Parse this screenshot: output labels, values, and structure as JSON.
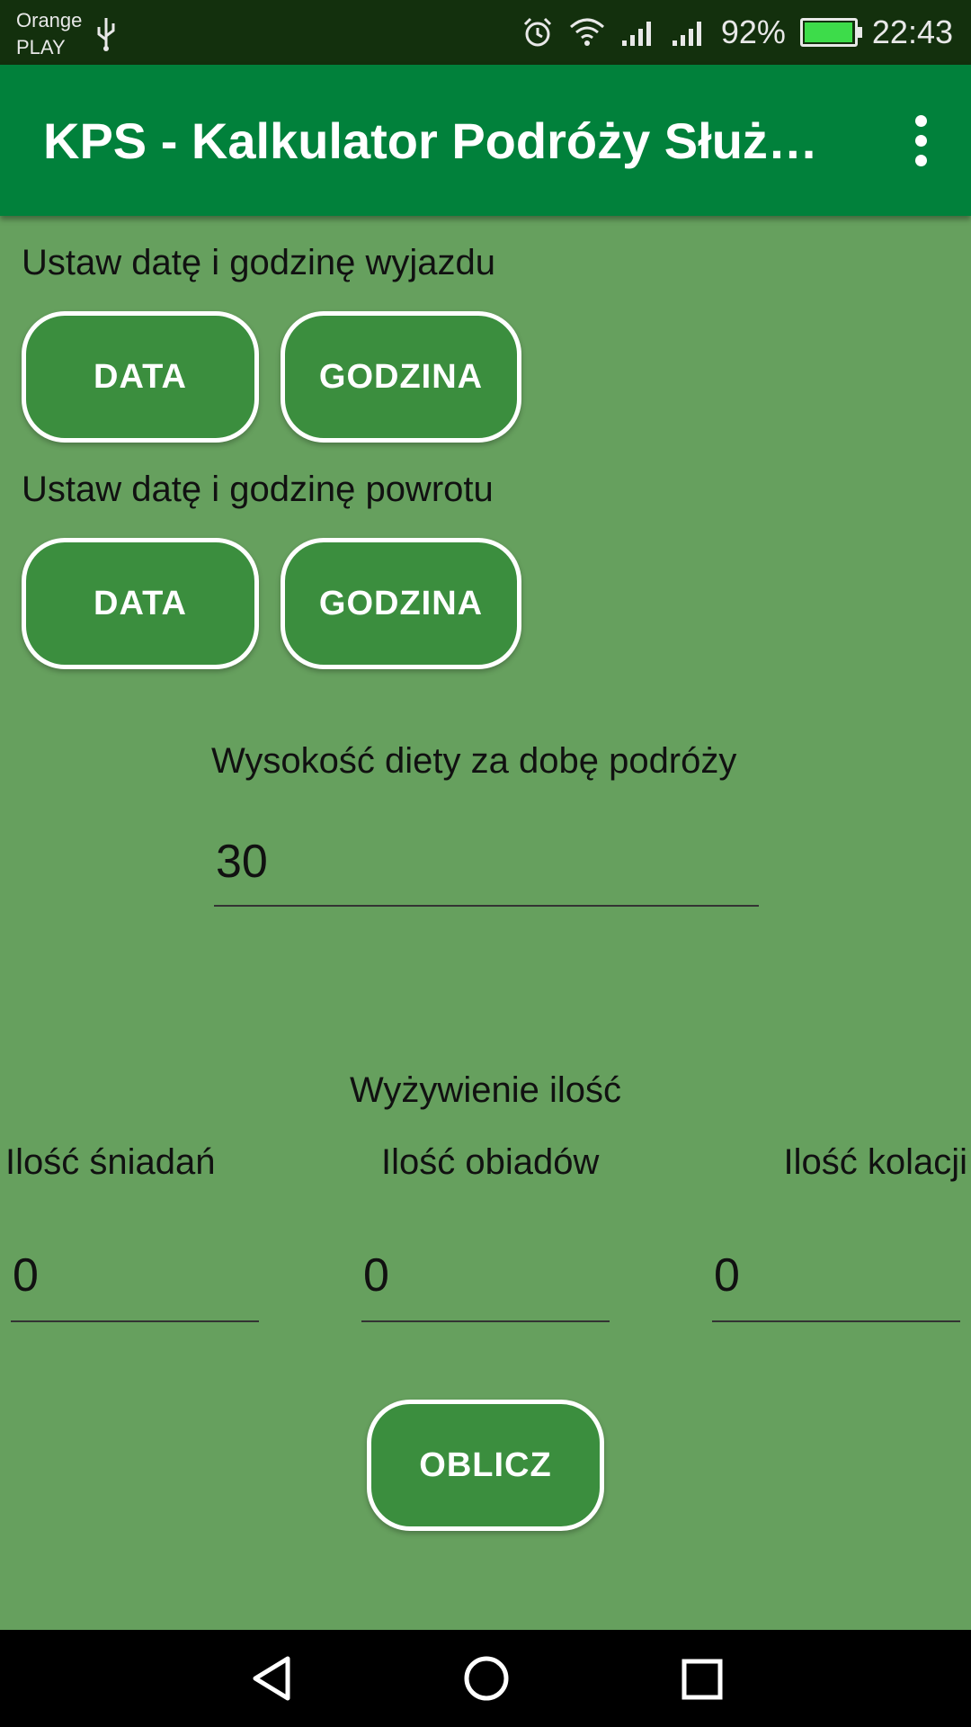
{
  "status_bar": {
    "carrier_line1": "Orange",
    "carrier_line2": "PLAY",
    "battery_percent": "92%",
    "time": "22:43",
    "icons": [
      "usb-icon",
      "alarm-icon",
      "wifi-icon",
      "signal-icon",
      "signal-icon",
      "battery-icon"
    ]
  },
  "app_bar": {
    "title": "KPS - Kalkulator Podróży Służbowych",
    "menu_icon": "more-vert-icon",
    "color": "#01813b"
  },
  "departure": {
    "label": "Ustaw datę i godzinę wyjazdu",
    "date_button": "DATA",
    "time_button": "GODZINA"
  },
  "return": {
    "label": "Ustaw datę i godzinę powrotu",
    "date_button": "DATA",
    "time_button": "GODZINA"
  },
  "diet": {
    "label": "Wysokość diety za dobę podróży",
    "value": "30"
  },
  "meals": {
    "header": "Wyżywienie ilość",
    "breakfast_label": "Ilość śniadań",
    "breakfast_value": "0",
    "lunch_label": "Ilość obiadów",
    "lunch_value": "0",
    "dinner_label": "Ilość kolacji",
    "dinner_value": "0"
  },
  "calculate_button": "OBLICZ",
  "nav_bar": {
    "icons": [
      "back-icon",
      "home-icon",
      "recents-icon"
    ]
  },
  "colors": {
    "background": "#66a05e",
    "button": "#3b8e3e",
    "status_bar": "#13300d"
  }
}
